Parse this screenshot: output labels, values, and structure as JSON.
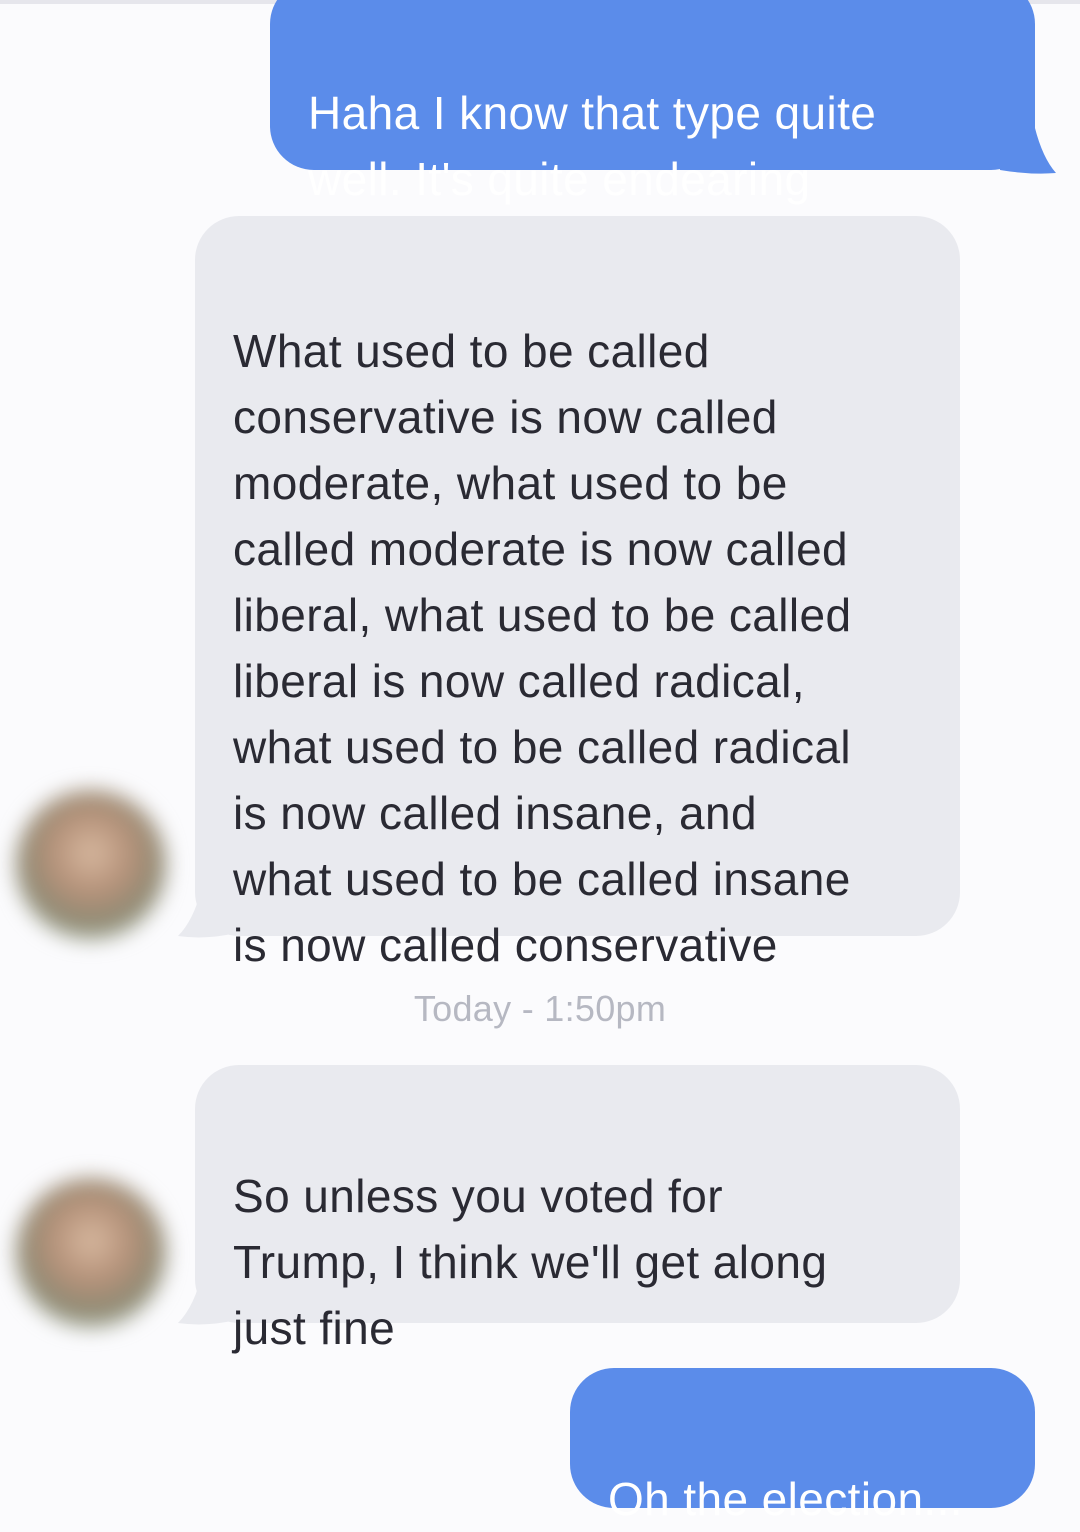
{
  "conversation": {
    "messages": [
      {
        "direction": "outgoing",
        "text": "Haha I know that type quite\nwell. It's quite endearing"
      },
      {
        "direction": "incoming",
        "text": "What used to be called\nconservative is now called\nmoderate, what used to be\ncalled moderate is now called\nliberal, what used to be called\nliberal is now called radical,\nwhat used to be called radical\nis now called insane, and\nwhat used to be called insane\nis now called conservative"
      },
      {
        "direction": "incoming",
        "text": "So unless you voted for\nTrump, I think we'll get along\njust fine"
      },
      {
        "direction": "outgoing",
        "text": "Oh the election..."
      }
    ],
    "timestamp": "Today - 1:50pm"
  },
  "colors": {
    "outgoing_bubble": "#5b8cea",
    "incoming_bubble": "#e9eaef",
    "timestamp_text": "#b6b8c2"
  }
}
